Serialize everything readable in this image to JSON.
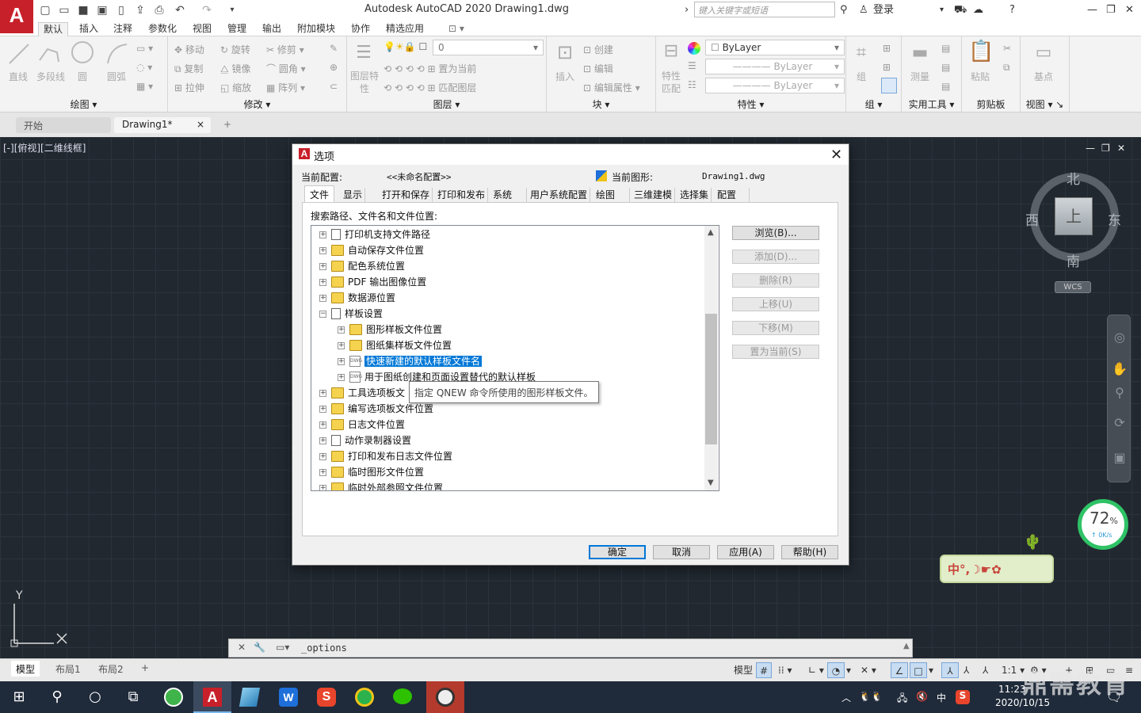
{
  "window": {
    "title": "Autodesk AutoCAD 2020    Drawing1.dwg",
    "app_logo": "A",
    "search_placeholder": "键入关键字或短语",
    "login": "登录"
  },
  "ribbon": {
    "tabs": [
      "默认",
      "插入",
      "注释",
      "参数化",
      "视图",
      "管理",
      "输出",
      "附加模块",
      "协作",
      "精选应用"
    ],
    "active_tab": "默认",
    "draw": {
      "name": "绘图",
      "line": "直线",
      "polyline": "多段线",
      "circle": "圆",
      "arc": "圆弧"
    },
    "modify": {
      "name": "修改",
      "move": "移动",
      "rotate": "旋转",
      "trim": "修剪",
      "copy": "复制",
      "mirror": "镜像",
      "fillet": "圆角",
      "stretch": "拉伸",
      "scale": "缩放",
      "array": "阵列"
    },
    "layer": {
      "name": "图层",
      "props": "图层特性",
      "current_layer": "0",
      "set_current": "置为当前",
      "match": "匹配图层"
    },
    "block": {
      "name": "块",
      "insert": "插入",
      "create": "创建",
      "edit": "编辑",
      "edit_attr": "编辑属性"
    },
    "properties": {
      "name": "特性",
      "match": "特性匹配",
      "color": "ByLayer",
      "linetype": "ByLayer",
      "lineweight": "ByLayer"
    },
    "groups": {
      "name": "组",
      "group": "组"
    },
    "utilities": {
      "name": "实用工具",
      "measure": "测量"
    },
    "clipboard": {
      "name": "剪贴板",
      "paste": "粘贴"
    },
    "view": {
      "name": "视图",
      "base": "基点"
    }
  },
  "doc_tabs": {
    "start": "开始",
    "drawing": "Drawing1*",
    "close": "×",
    "add": "+"
  },
  "viewport": {
    "label": "[-][俯视][二维线框]",
    "compass": {
      "north": "北",
      "south": "南",
      "east": "东",
      "west": "西",
      "top": "上",
      "wcs": "WCS"
    },
    "ucs": {
      "y": "Y"
    }
  },
  "speed_widget": {
    "percent": "72",
    "unit": "%",
    "rate": "0K/s"
  },
  "ime_bar": "中°,☽☛✿",
  "command_line": {
    "text": "_options"
  },
  "status": {
    "model_tab": "模型",
    "layout1": "布局1",
    "layout2": "布局2",
    "add": "+",
    "model_btn": "模型",
    "scale": "1:1"
  },
  "dialog": {
    "title": "选项",
    "current_profile_label": "当前配置:",
    "current_profile": "<<未命名配置>>",
    "current_drawing_label": "当前图形:",
    "current_drawing": "Drawing1.dwg",
    "tabs": [
      "文件",
      "显示",
      "打开和保存",
      "打印和发布",
      "系统",
      "用户系统配置",
      "绘图",
      "三维建模",
      "选择集",
      "配置"
    ],
    "active_tab": "文件",
    "search_label": "搜索路径、文件名和文件位置:",
    "tree": [
      {
        "label": "打印机支持文件路径",
        "level": 0,
        "icon": "file",
        "exp": "+"
      },
      {
        "label": "自动保存文件位置",
        "level": 0,
        "icon": "folder",
        "exp": "+"
      },
      {
        "label": "配色系统位置",
        "level": 0,
        "icon": "folder",
        "exp": "+"
      },
      {
        "label": "PDF 输出图像位置",
        "level": 0,
        "icon": "folder",
        "exp": "+"
      },
      {
        "label": "数据源位置",
        "level": 0,
        "icon": "folder",
        "exp": "+"
      },
      {
        "label": "样板设置",
        "level": 0,
        "icon": "file",
        "exp": "−"
      },
      {
        "label": "图形样板文件位置",
        "level": 1,
        "icon": "folder",
        "exp": "+"
      },
      {
        "label": "图纸集样板文件位置",
        "level": 1,
        "icon": "folder",
        "exp": "+"
      },
      {
        "label": "快速新建的默认样板文件名",
        "level": 1,
        "icon": "dwg",
        "exp": "+",
        "selected": true
      },
      {
        "label": "用于图纸创建和页面设置替代的默认样板",
        "level": 1,
        "icon": "dwg",
        "exp": "+"
      },
      {
        "label": "工具选项板文",
        "level": 0,
        "icon": "folder",
        "exp": "+"
      },
      {
        "label": "编写选项板文件位置",
        "level": 0,
        "icon": "folder",
        "exp": "+"
      },
      {
        "label": "日志文件位置",
        "level": 0,
        "icon": "folder",
        "exp": "+"
      },
      {
        "label": "动作录制器设置",
        "level": 0,
        "icon": "file",
        "exp": "+"
      },
      {
        "label": "打印和发布日志文件位置",
        "level": 0,
        "icon": "folder",
        "exp": "+"
      },
      {
        "label": "临时图形文件位置",
        "level": 0,
        "icon": "folder",
        "exp": "+"
      },
      {
        "label": "临时外部参照文件位置",
        "level": 0,
        "icon": "folder",
        "exp": "+"
      }
    ],
    "tooltip": "指定 QNEW 命令所使用的图形样板文件。",
    "side_buttons": [
      {
        "label": "浏览(B)...",
        "enabled": true
      },
      {
        "label": "添加(D)...",
        "enabled": false
      },
      {
        "label": "删除(R)",
        "enabled": false
      },
      {
        "label": "上移(U)",
        "enabled": false
      },
      {
        "label": "下移(M)",
        "enabled": false
      },
      {
        "label": "置为当前(S)",
        "enabled": false
      }
    ],
    "ok": "确定",
    "cancel": "取消",
    "apply": "应用(A)",
    "help": "帮助(H)"
  },
  "taskbar": {
    "time": "11:23",
    "date": "2020/10/15",
    "ime": "中",
    "watermark": "鼎需教育"
  }
}
